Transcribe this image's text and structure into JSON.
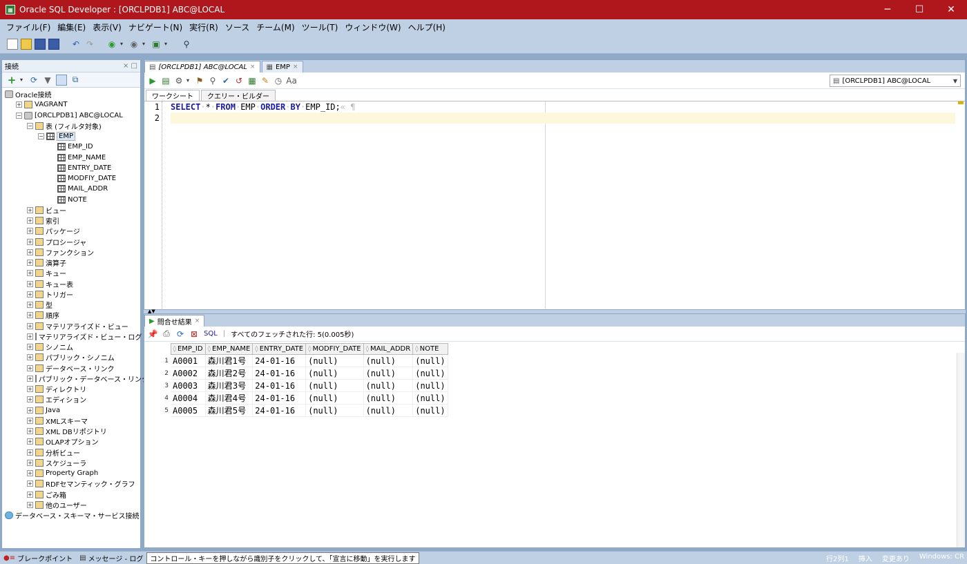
{
  "window": {
    "title": "Oracle SQL Developer : [ORCLPDB1] ABC@LOCAL",
    "minimize": "─",
    "maximize": "☐",
    "close": "✕"
  },
  "menu": [
    "ファイル(F)",
    "編集(E)",
    "表示(V)",
    "ナビゲート(N)",
    "実行(R)",
    "ソース",
    "チーム(M)",
    "ツール(T)",
    "ウィンドウ(W)",
    "ヘルプ(H)"
  ],
  "connections_panel": {
    "title": "接続",
    "controls": "× □",
    "tree": [
      {
        "label": "Oracle接続",
        "indent": 0,
        "toggle": "",
        "icon": "db"
      },
      {
        "label": "VAGRANT",
        "indent": 1,
        "toggle": "+",
        "icon": "folder"
      },
      {
        "label": "[ORCLPDB1] ABC@LOCAL",
        "indent": 1,
        "toggle": "−",
        "icon": "db"
      },
      {
        "label": "表 (フィルタ対象)",
        "indent": 2,
        "toggle": "−",
        "icon": "folder"
      },
      {
        "label": "EMP",
        "indent": 3,
        "toggle": "−",
        "icon": "tbl",
        "selected": true
      },
      {
        "label": "EMP_ID",
        "indent": 4,
        "toggle": "",
        "icon": "tbl"
      },
      {
        "label": "EMP_NAME",
        "indent": 4,
        "toggle": "",
        "icon": "tbl"
      },
      {
        "label": "ENTRY_DATE",
        "indent": 4,
        "toggle": "",
        "icon": "tbl"
      },
      {
        "label": "MODFIY_DATE",
        "indent": 4,
        "toggle": "",
        "icon": "tbl"
      },
      {
        "label": "MAIL_ADDR",
        "indent": 4,
        "toggle": "",
        "icon": "tbl"
      },
      {
        "label": "NOTE",
        "indent": 4,
        "toggle": "",
        "icon": "tbl"
      },
      {
        "label": "ビュー",
        "indent": 2,
        "toggle": "+",
        "icon": "folder"
      },
      {
        "label": "索引",
        "indent": 2,
        "toggle": "+",
        "icon": "folder"
      },
      {
        "label": "パッケージ",
        "indent": 2,
        "toggle": "+",
        "icon": "folder"
      },
      {
        "label": "プロシージャ",
        "indent": 2,
        "toggle": "+",
        "icon": "folder"
      },
      {
        "label": "ファンクション",
        "indent": 2,
        "toggle": "+",
        "icon": "folder"
      },
      {
        "label": "演算子",
        "indent": 2,
        "toggle": "+",
        "icon": "folder"
      },
      {
        "label": "キュー",
        "indent": 2,
        "toggle": "+",
        "icon": "folder"
      },
      {
        "label": "キュー表",
        "indent": 2,
        "toggle": "+",
        "icon": "folder"
      },
      {
        "label": "トリガー",
        "indent": 2,
        "toggle": "+",
        "icon": "folder"
      },
      {
        "label": "型",
        "indent": 2,
        "toggle": "+",
        "icon": "folder"
      },
      {
        "label": "順序",
        "indent": 2,
        "toggle": "+",
        "icon": "folder"
      },
      {
        "label": "マテリアライズド・ビュー",
        "indent": 2,
        "toggle": "+",
        "icon": "folder"
      },
      {
        "label": "マテリアライズド・ビュー・ログ",
        "indent": 2,
        "toggle": "+",
        "icon": "folder"
      },
      {
        "label": "シノニム",
        "indent": 2,
        "toggle": "+",
        "icon": "folder"
      },
      {
        "label": "パブリック・シノニム",
        "indent": 2,
        "toggle": "+",
        "icon": "folder"
      },
      {
        "label": "データベース・リンク",
        "indent": 2,
        "toggle": "+",
        "icon": "folder"
      },
      {
        "label": "パブリック・データベース・リンク",
        "indent": 2,
        "toggle": "+",
        "icon": "folder"
      },
      {
        "label": "ディレクトリ",
        "indent": 2,
        "toggle": "+",
        "icon": "folder"
      },
      {
        "label": "エディション",
        "indent": 2,
        "toggle": "+",
        "icon": "folder"
      },
      {
        "label": "Java",
        "indent": 2,
        "toggle": "+",
        "icon": "folder"
      },
      {
        "label": "XMLスキーマ",
        "indent": 2,
        "toggle": "+",
        "icon": "folder"
      },
      {
        "label": "XML DBリポジトリ",
        "indent": 2,
        "toggle": "+",
        "icon": "folder"
      },
      {
        "label": "OLAPオプション",
        "indent": 2,
        "toggle": "+",
        "icon": "folder"
      },
      {
        "label": "分析ビュー",
        "indent": 2,
        "toggle": "+",
        "icon": "folder"
      },
      {
        "label": "スケジューラ",
        "indent": 2,
        "toggle": "+",
        "icon": "folder"
      },
      {
        "label": "Property Graph",
        "indent": 2,
        "toggle": "+",
        "icon": "folder"
      },
      {
        "label": "RDFセマンティック・グラフ",
        "indent": 2,
        "toggle": "+",
        "icon": "folder"
      },
      {
        "label": "ごみ箱",
        "indent": 2,
        "toggle": "+",
        "icon": "folder"
      },
      {
        "label": "他のユーザー",
        "indent": 2,
        "toggle": "+",
        "icon": "folder"
      },
      {
        "label": "データベース・スキーマ・サービス接続",
        "indent": 0,
        "toggle": "",
        "icon": "cloud"
      }
    ]
  },
  "editor": {
    "tabs": [
      {
        "label": "[ORCLPDB1] ABC@LOCAL",
        "close": "×",
        "active": true
      },
      {
        "label": "EMP",
        "close": "×",
        "active": false
      }
    ],
    "connection": "[ORCLPDB1] ABC@LOCAL",
    "subtabs": [
      "ワークシート",
      "クエリー・ビルダー"
    ],
    "line_numbers": [
      "1",
      "2"
    ],
    "sql": {
      "select": "SELECT",
      "star": "*",
      "from": "FROM",
      "table": "EMP",
      "order": "ORDER",
      "by": "BY",
      "column": "EMP_ID;",
      "eol": "« ¶"
    }
  },
  "results": {
    "tab": "問合せ結果",
    "tab_close": "×",
    "sql_link": "SQL",
    "status": "すべてのフェッチされた行: 5(0.005秒)",
    "columns": [
      "EMP_ID",
      "EMP_NAME",
      "ENTRY_DATE",
      "MODFIY_DATE",
      "MAIL_ADDR",
      "NOTE"
    ],
    "rows": [
      [
        "1",
        "A0001",
        "森川君1号",
        "24-01-16",
        "(null)",
        "(null)",
        "(null)"
      ],
      [
        "2",
        "A0002",
        "森川君2号",
        "24-01-16",
        "(null)",
        "(null)",
        "(null)"
      ],
      [
        "3",
        "A0003",
        "森川君3号",
        "24-01-16",
        "(null)",
        "(null)",
        "(null)"
      ],
      [
        "4",
        "A0004",
        "森川君4号",
        "24-01-16",
        "(null)",
        "(null)",
        "(null)"
      ],
      [
        "5",
        "A0005",
        "森川君5号",
        "24-01-16",
        "(null)",
        "(null)",
        "(null)"
      ]
    ]
  },
  "statusbar": {
    "breakpoints": "ブレークポイント",
    "messages": "メッセージ - ログ",
    "message": "コントロール・キーを押しながら識別子をクリックして、「宣言に移動」を実行します",
    "position": "行2列1",
    "mode": "挿入",
    "modified": "変更あり",
    "platform": "Windows: CR"
  }
}
